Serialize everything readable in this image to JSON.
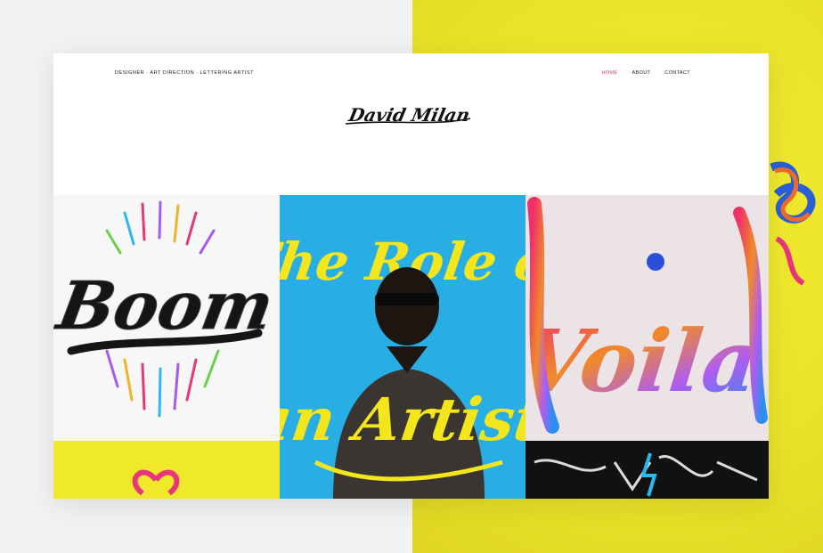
{
  "header": {
    "tagline": "DESIGNER · ART DIRECTION · LETTERING ARTIST",
    "logo_text": "David Milan"
  },
  "nav": {
    "items": [
      {
        "label": "HOME",
        "active": true
      },
      {
        "label": "ABOUT",
        "active": false
      },
      {
        "label": "CONTACT",
        "active": false
      }
    ]
  },
  "gallery": {
    "tiles": [
      {
        "artwork": "Boom"
      },
      {
        "artwork_line1": "The Role of",
        "artwork_line2": "an Artist"
      },
      {
        "artwork": "Voila"
      }
    ]
  },
  "colors": {
    "accent": "#e8367a",
    "yellow": "#ece42a",
    "blue": "#28aee4",
    "lettering_yellow": "#f3e61c"
  }
}
